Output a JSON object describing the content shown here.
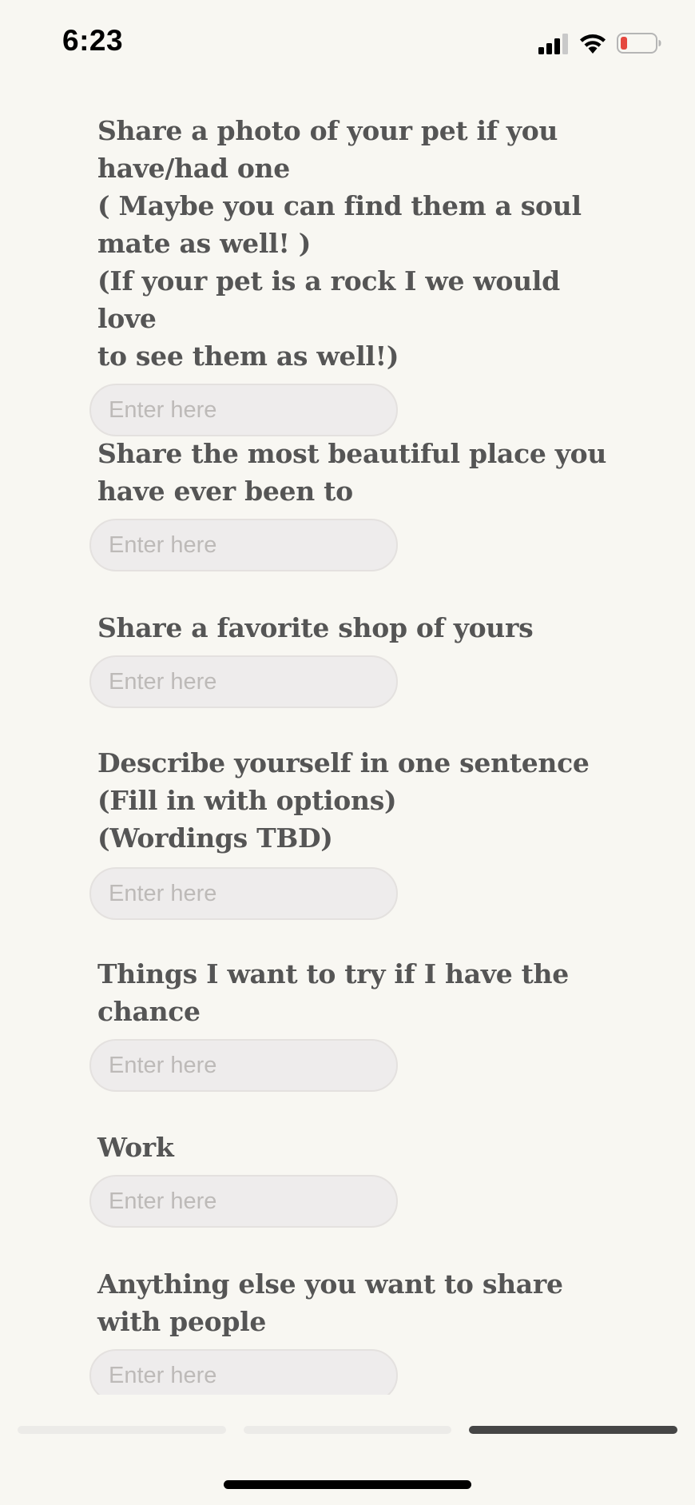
{
  "status_bar": {
    "time": "6:23",
    "icons": [
      "cellular-signal-icon",
      "wifi-icon",
      "battery-low-icon"
    ],
    "battery_color": "#e5483f"
  },
  "form": {
    "placeholder": "Enter here",
    "questions": [
      {
        "label": "Share a photo of your pet if you\nhave/had one\n( Maybe you can find them a soul\nmate as well! )\n(If your pet is a rock I we would love\nto see them as well!)"
      },
      {
        "label": "Share the most beautiful place you\nhave ever been to"
      },
      {
        "label": "Share a favorite shop of yours"
      },
      {
        "label": "Describe yourself in one sentence\n(Fill in with options)\n(Wordings TBD)"
      },
      {
        "label": "Things I want to try if I have the\nchance"
      },
      {
        "label": "Work"
      },
      {
        "label": "Anything else you want to share\nwith people"
      }
    ]
  },
  "progress": {
    "total_steps": 3,
    "current_step": 3
  },
  "colors": {
    "background": "#f8f7f2",
    "label_text": "#555555",
    "input_fill": "#eeecec",
    "placeholder_text": "#bdbab8",
    "progress_active": "#464646",
    "progress_inactive": "#ecebe8"
  }
}
